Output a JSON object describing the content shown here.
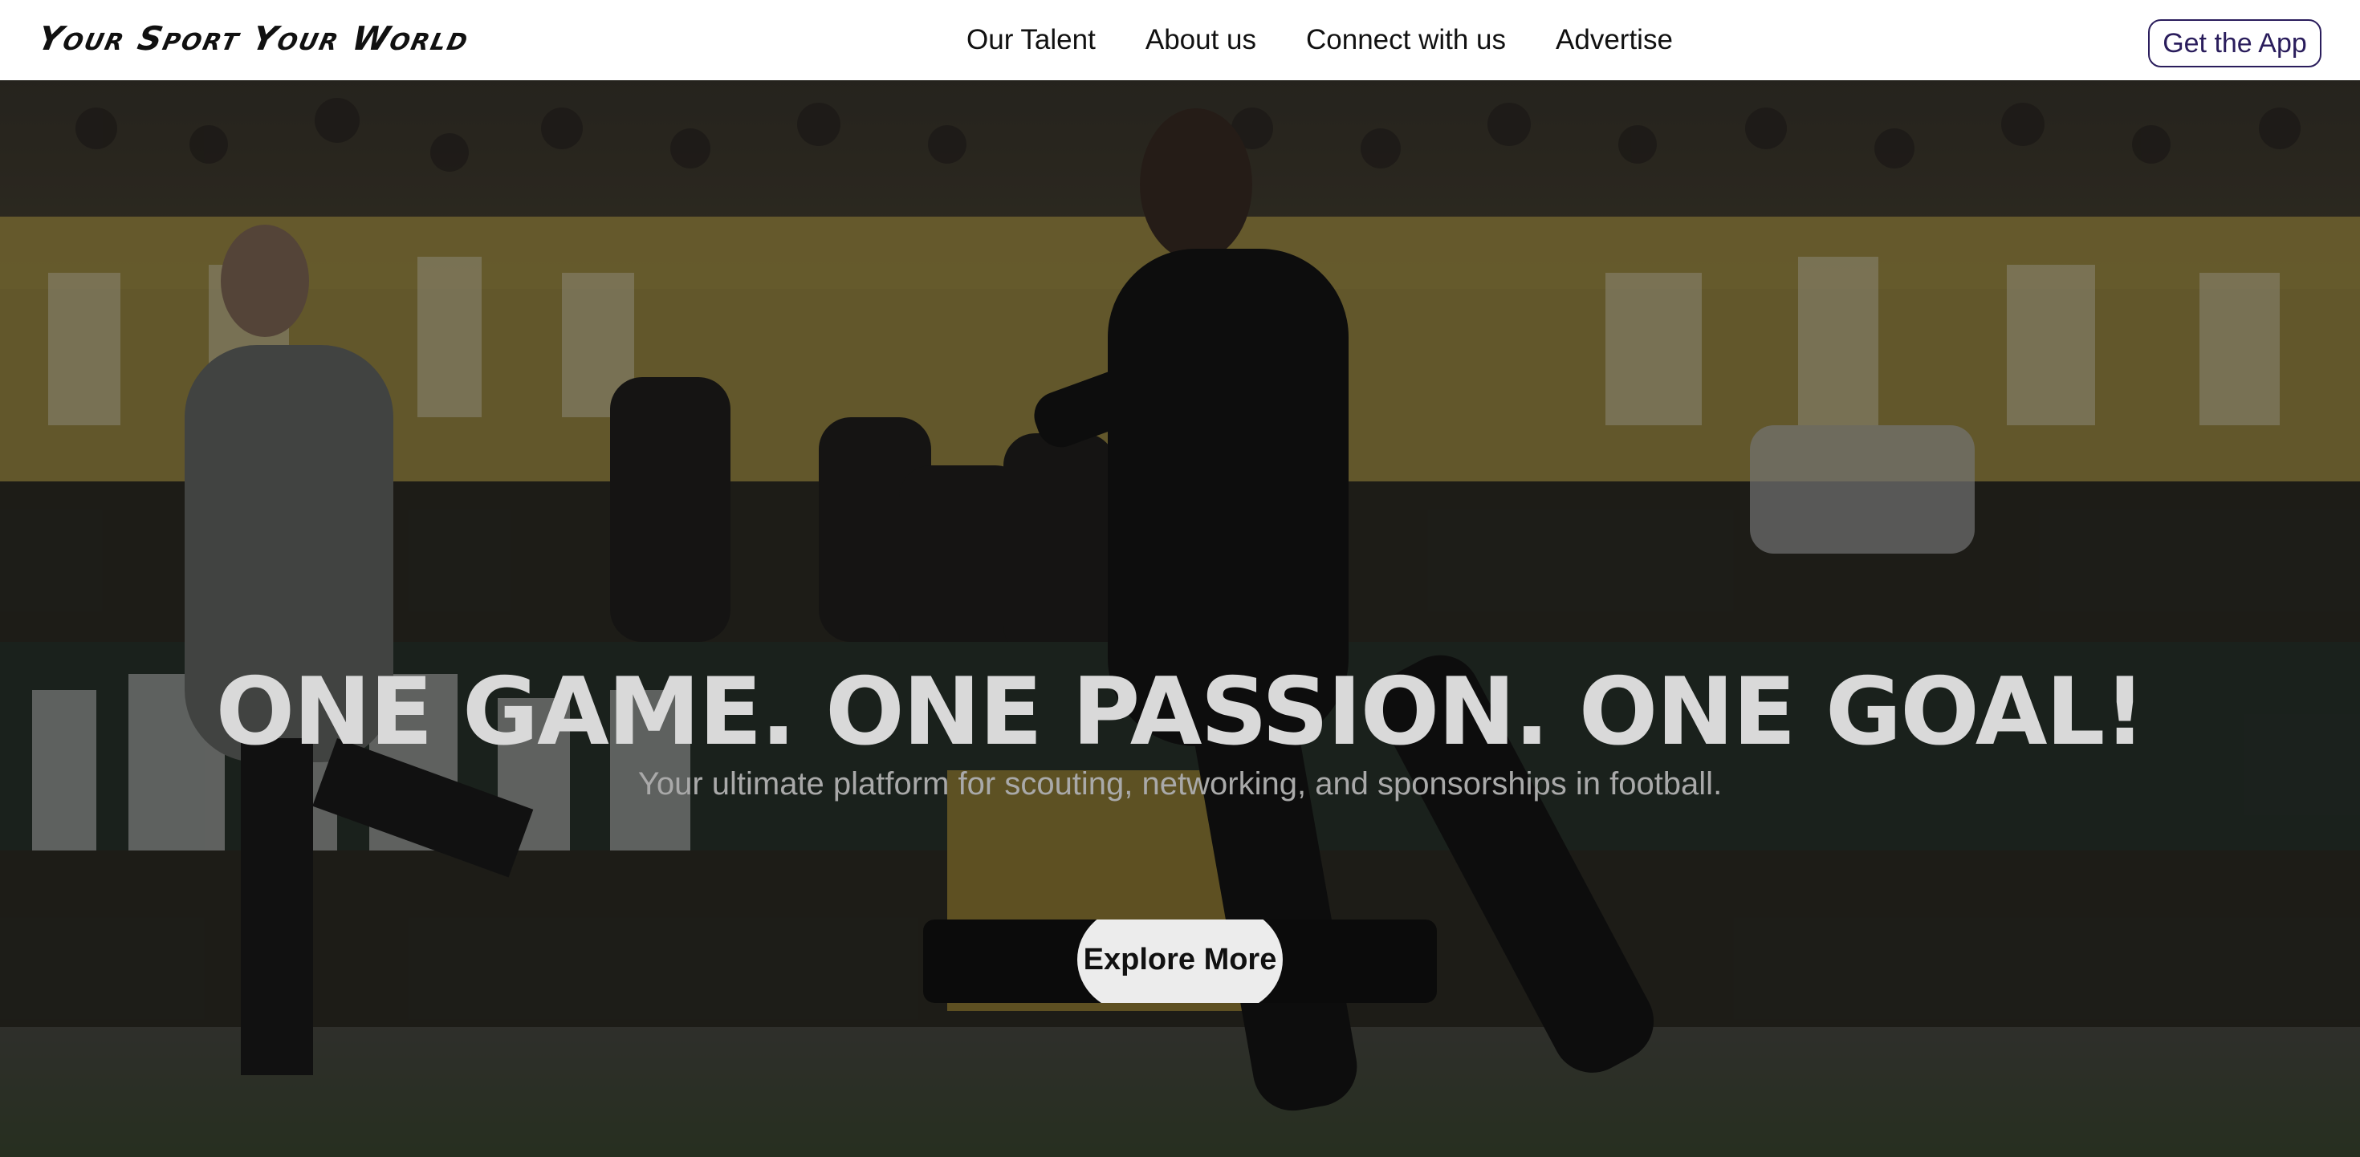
{
  "header": {
    "logo_text": "Your Sport Your World",
    "nav": [
      {
        "label": "Our Talent"
      },
      {
        "label": "About us"
      },
      {
        "label": "Connect with us"
      },
      {
        "label": "Advertise"
      }
    ],
    "cta_label": "Get the App"
  },
  "hero": {
    "background_image": "football-players-running-stadium-photo",
    "title": "ONE GAME. ONE PASSION. ONE GOAL!",
    "subtitle": "Your ultimate platform for scouting, networking, and sponsorships in football.",
    "button_label": "Explore More"
  },
  "colors": {
    "header_bg": "#ffffff",
    "cta_border": "#2a1d5c",
    "title_color": "#d9d9d9",
    "subtitle_color": "#a9a9a9",
    "button_bg": "#ececec",
    "button_shadow_bar": "#0b0b0b"
  }
}
